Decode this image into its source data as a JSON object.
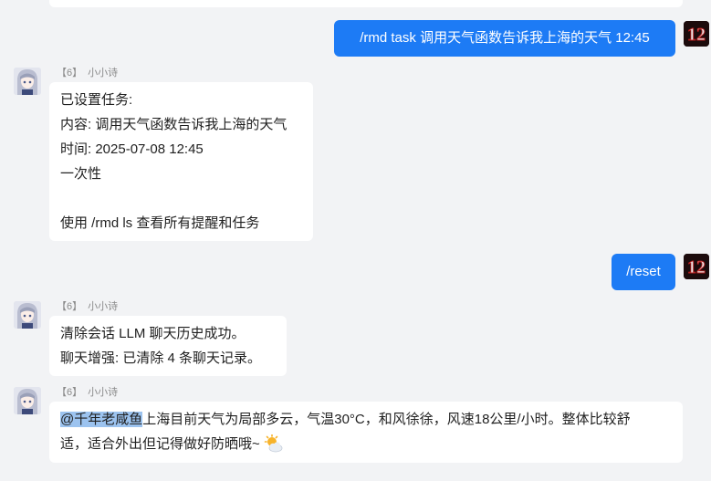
{
  "sender_tag": "【6】",
  "sender_name": "小小诗",
  "user_badge": "12",
  "messages": {
    "m1": "/rmd task 调用天气函数告诉我上海的天气 12:45",
    "m2": {
      "lines": [
        "已设置任务:",
        "内容: 调用天气函数告诉我上海的天气",
        "时间: 2025-07-08 12:45",
        "一次性",
        "",
        "使用 /rmd ls 查看所有提醒和任务"
      ]
    },
    "m3": "/reset",
    "m4": {
      "lines": [
        "清除会话 LLM 聊天历史成功。",
        "聊天增强: 已清除 4 条聊天记录。"
      ]
    },
    "m5": {
      "mention": "@千年老咸鱼",
      "line1_rest": "上海目前天气为局部多云，气温30°C，和风徐徐，风速18公里/小时。整体比较舒",
      "line2": "适，适合外出但记得做好防晒哦~",
      "emoji": "sun-behind-cloud"
    }
  }
}
